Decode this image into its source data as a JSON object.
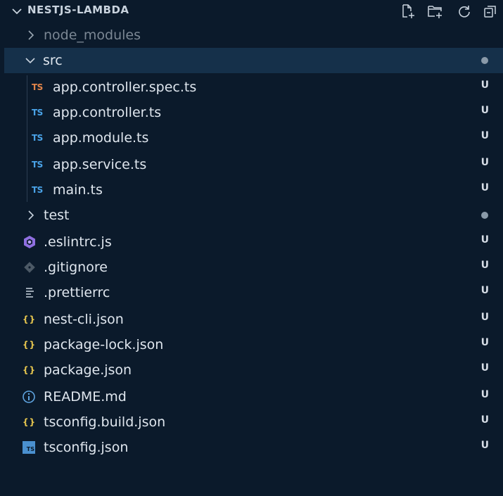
{
  "explorer": {
    "title": "NESTJS-LAMBDA",
    "actions": [
      {
        "name": "new-file-icon"
      },
      {
        "name": "new-folder-icon"
      },
      {
        "name": "refresh-icon"
      },
      {
        "name": "collapse-all-icon"
      }
    ]
  },
  "tree": [
    {
      "label": "node_modules",
      "type": "folder",
      "expanded": false,
      "dim": true,
      "status": ""
    },
    {
      "label": "src",
      "type": "folder",
      "expanded": true,
      "status": "dot"
    },
    {
      "label": "app.controller.spec.ts",
      "type": "ts-spec",
      "icon_text": "TS",
      "status": "U"
    },
    {
      "label": "app.controller.ts",
      "type": "ts",
      "icon_text": "TS",
      "status": "U"
    },
    {
      "label": "app.module.ts",
      "type": "ts",
      "icon_text": "TS",
      "status": "U"
    },
    {
      "label": "app.service.ts",
      "type": "ts",
      "icon_text": "TS",
      "status": "U"
    },
    {
      "label": "main.ts",
      "type": "ts",
      "icon_text": "TS",
      "status": "U"
    },
    {
      "label": "test",
      "type": "folder",
      "expanded": false,
      "status": "dot"
    },
    {
      "label": ".eslintrc.js",
      "type": "eslint",
      "status": "U"
    },
    {
      "label": ".gitignore",
      "type": "git",
      "status": "U"
    },
    {
      "label": ".prettierrc",
      "type": "prettier",
      "status": "U"
    },
    {
      "label": "nest-cli.json",
      "type": "json",
      "icon_text": "{}",
      "status": "U"
    },
    {
      "label": "package-lock.json",
      "type": "json",
      "icon_text": "{}",
      "status": "U"
    },
    {
      "label": "package.json",
      "type": "json",
      "icon_text": "{}",
      "status": "U"
    },
    {
      "label": "README.md",
      "type": "info",
      "status": "U"
    },
    {
      "label": "tsconfig.build.json",
      "type": "json",
      "icon_text": "{}",
      "status": "U"
    },
    {
      "label": "tsconfig.json",
      "type": "tsconfig",
      "icon_text": "TS",
      "status": "U"
    }
  ],
  "colors": {
    "background": "#0b1a2b",
    "selected": "#15304a",
    "ts": "#4aa3e8",
    "spec": "#e2854a",
    "json": "#e9c84f",
    "eslint": "#8f6fe0"
  }
}
